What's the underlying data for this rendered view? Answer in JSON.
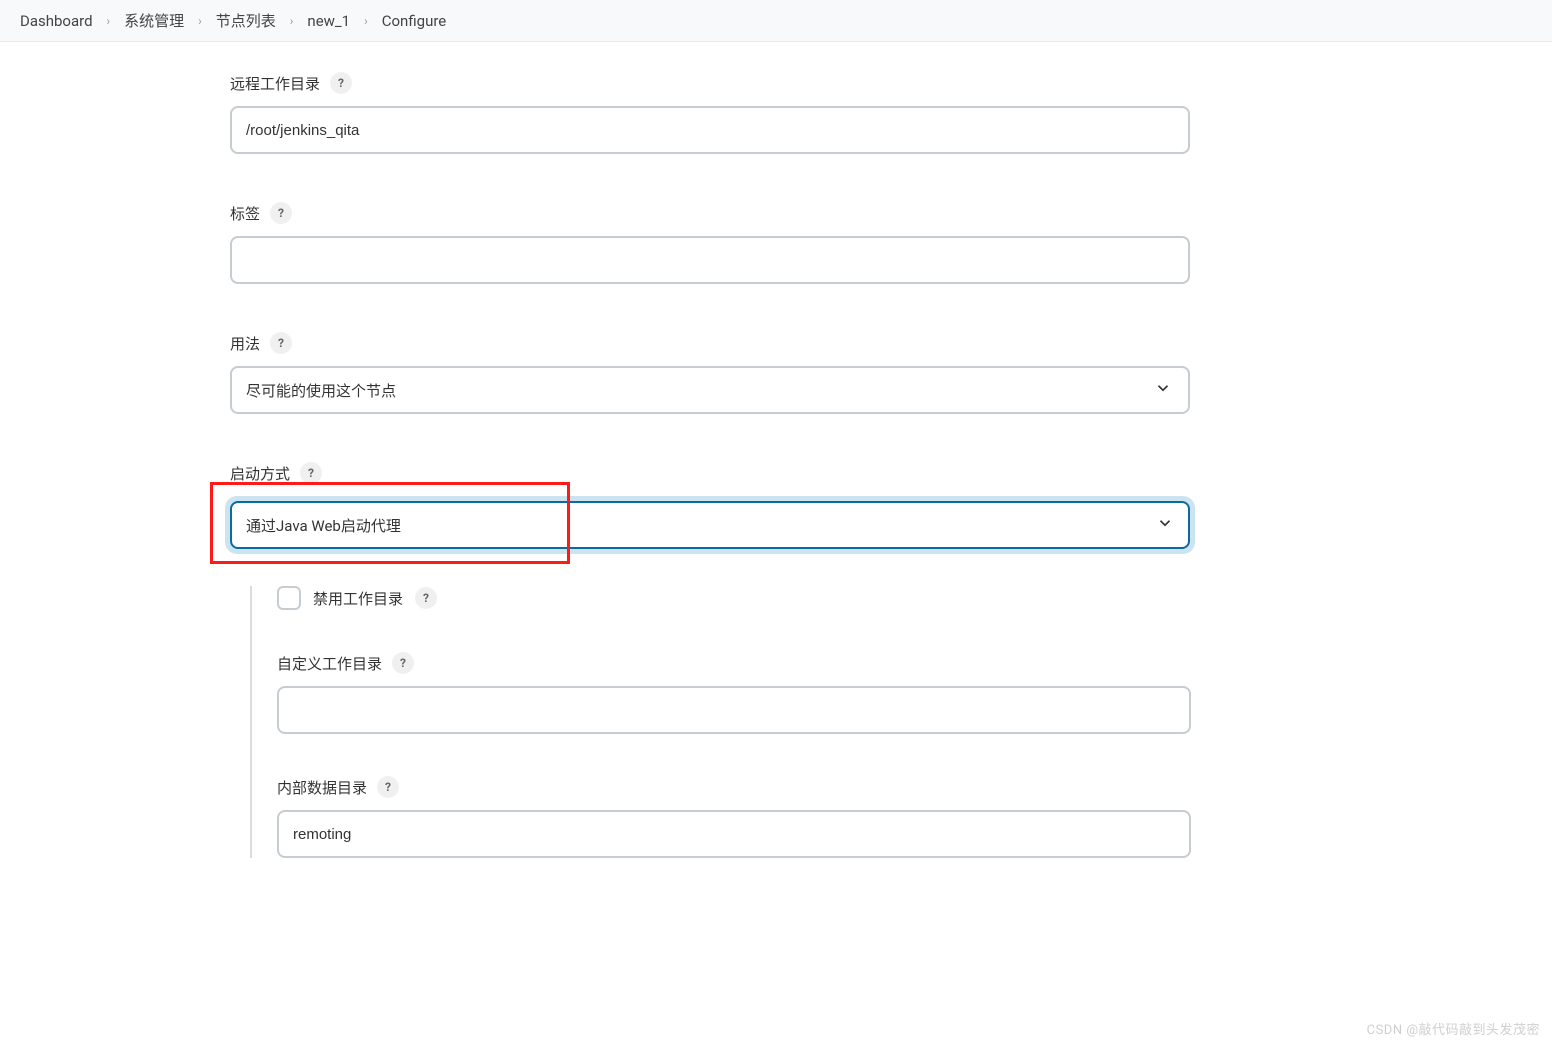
{
  "breadcrumb": {
    "items": [
      {
        "label": "Dashboard"
      },
      {
        "label": "系统管理"
      },
      {
        "label": "节点列表"
      },
      {
        "label": "new_1"
      },
      {
        "label": "Configure"
      }
    ]
  },
  "form": {
    "remote_root": {
      "label": "远程工作目录",
      "value": "/root/jenkins_qita"
    },
    "labels": {
      "label": "标签",
      "value": ""
    },
    "usage": {
      "label": "用法",
      "selected": "尽可能的使用这个节点"
    },
    "launch_method": {
      "label": "启动方式",
      "selected": "通过Java Web启动代理"
    },
    "disable_workdir": {
      "label": "禁用工作目录"
    },
    "custom_workdir": {
      "label": "自定义工作目录",
      "value": ""
    },
    "internal_data_dir": {
      "label": "内部数据目录",
      "value": "remoting"
    }
  },
  "help_symbol": "?",
  "watermark": "CSDN @敲代码敲到头发茂密"
}
